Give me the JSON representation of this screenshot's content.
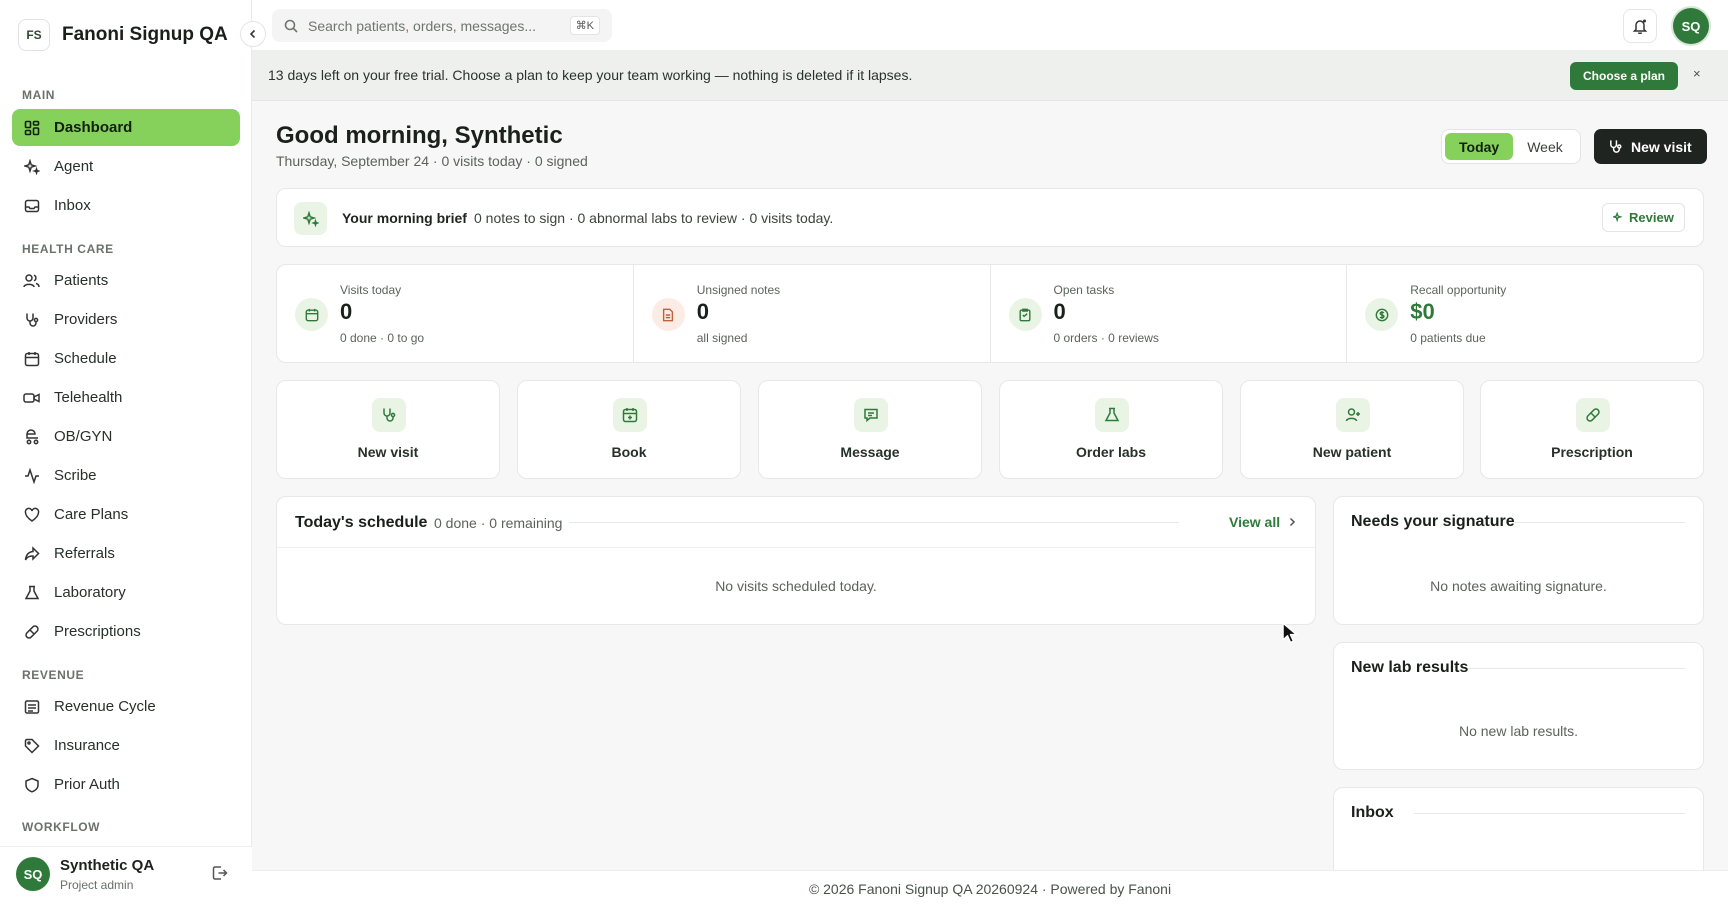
{
  "brand": {
    "initials": "FS",
    "name": "Fanoni Signup QA ..."
  },
  "search": {
    "placeholder": "Search patients, orders, messages...",
    "shortcut": "⌘K"
  },
  "user": {
    "initials": "SQ",
    "name": "Synthetic QA",
    "role": "Project admin"
  },
  "sidebar": {
    "sections": {
      "main": "MAIN",
      "health": "HEALTH CARE",
      "revenue": "REVENUE",
      "workflow": "WORKFLOW"
    },
    "items": {
      "dashboard": "Dashboard",
      "agent": "Agent",
      "inbox": "Inbox",
      "patients": "Patients",
      "providers": "Providers",
      "schedule": "Schedule",
      "telehealth": "Telehealth",
      "obgyn": "OB/GYN",
      "scribe": "Scribe",
      "careplans": "Care Plans",
      "referrals": "Referrals",
      "laboratory": "Laboratory",
      "prescriptions": "Prescriptions",
      "revenuecycle": "Revenue Cycle",
      "insurance": "Insurance",
      "priorauth": "Prior Auth"
    }
  },
  "banner": {
    "text": "13 days left on your free trial. Choose a plan to keep your team working — nothing is deleted if it lapses.",
    "button": "Choose a plan",
    "close": "×"
  },
  "header": {
    "greeting": "Good morning, Synthetic",
    "subtitle": "Thursday, September 24 · 0 visits today · 0 signed",
    "toggle": {
      "today": "Today",
      "week": "Week"
    },
    "new_visit": "New visit"
  },
  "brief": {
    "title": "Your morning brief",
    "text": "0 notes to sign · 0 abnormal labs to review · 0 visits today.",
    "button": "Review"
  },
  "stats": {
    "visits": {
      "label": "Visits today",
      "value": "0",
      "sub": "0 done · 0 to go"
    },
    "unsigned": {
      "label": "Unsigned notes",
      "value": "0",
      "sub": "all signed"
    },
    "tasks": {
      "label": "Open tasks",
      "value": "0",
      "sub": "0 orders · 0 reviews"
    },
    "recall": {
      "label": "Recall opportunity",
      "value": "$0",
      "sub": "0 patients due"
    }
  },
  "actions": {
    "new_visit": "New visit",
    "book": "Book",
    "message": "Message",
    "order_labs": "Order labs",
    "new_patient": "New patient",
    "prescription": "Prescription"
  },
  "schedule": {
    "title": "Today's schedule",
    "meta": "0 done · 0 remaining",
    "view_all": "View all",
    "empty": "No visits scheduled today."
  },
  "signature": {
    "title": "Needs your signature",
    "empty": "No notes awaiting signature."
  },
  "labs": {
    "title": "New lab results",
    "empty": "No new lab results."
  },
  "inbox_card": {
    "title": "Inbox"
  },
  "footer": {
    "text": "© 2026 Fanoni Signup QA 20260924 · Powered by Fanoni"
  },
  "colors": {
    "accent": "#86d05c",
    "brand_dark": "#2f7a3a",
    "ink": "#1f2421"
  }
}
